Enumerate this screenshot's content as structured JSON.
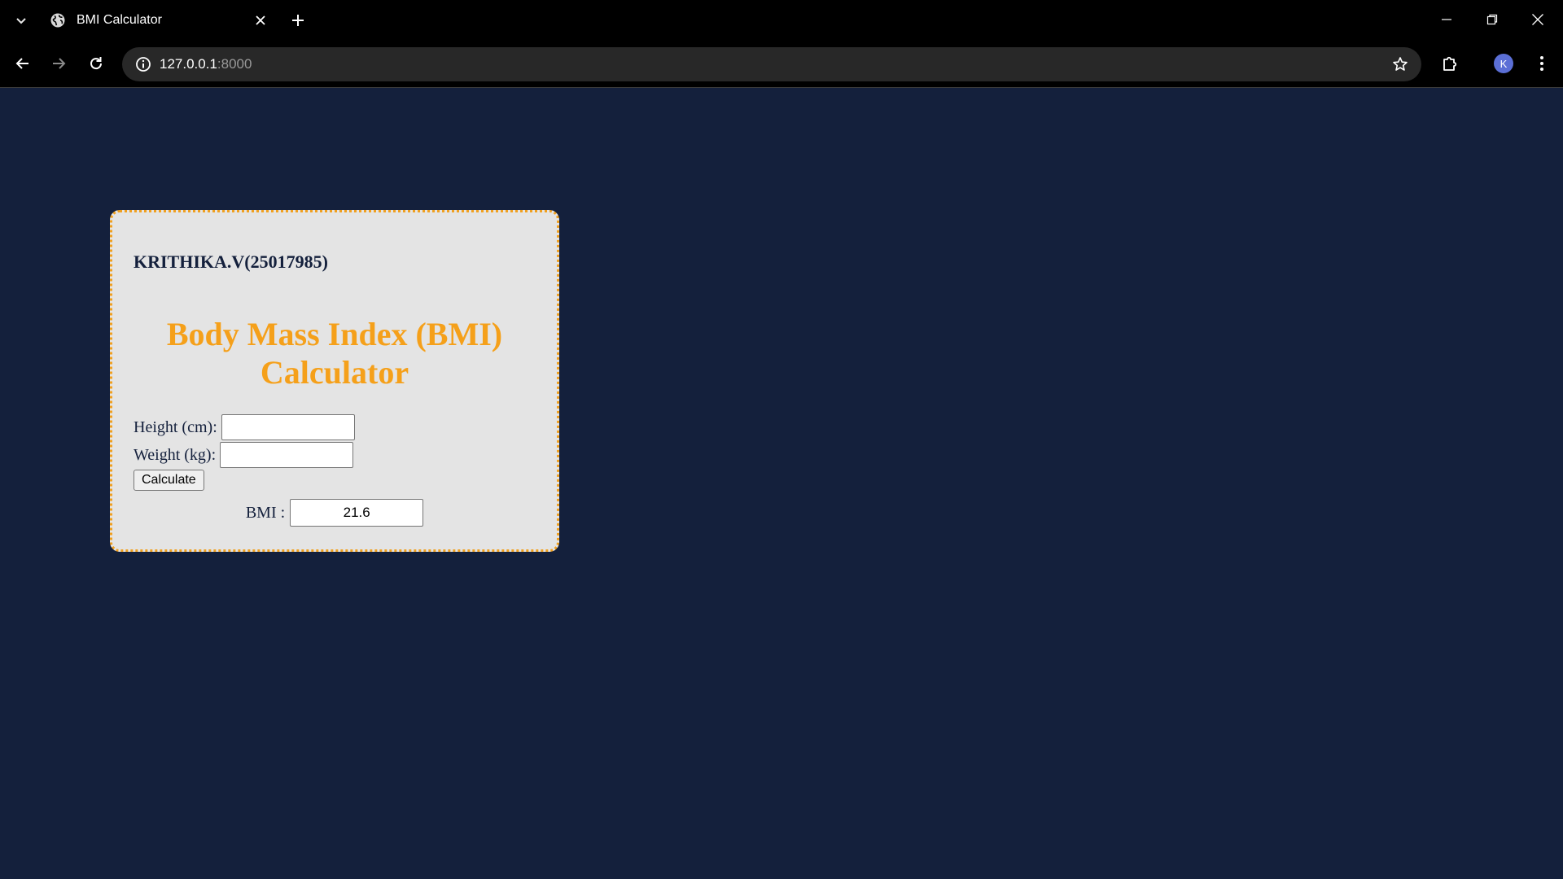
{
  "browser": {
    "tab": {
      "title": "BMI Calculator"
    },
    "address": {
      "host": "127.0.0.1",
      "port": ":8000"
    },
    "profile_initial": "K"
  },
  "page": {
    "student_label": "KRITHIKA.V(25017985)",
    "heading": "Body Mass Index (BMI) Calculator",
    "form": {
      "height_label": "Height (cm):",
      "height_value": "",
      "weight_label": "Weight (kg):",
      "weight_value": "",
      "calculate_label": "Calculate",
      "bmi_label": "BMI :",
      "bmi_value": "21.6"
    }
  },
  "colors": {
    "page_background": "#14203c",
    "card_background": "#e4e4e4",
    "card_border": "#f0a020",
    "heading": "#f5a01a",
    "avatar": "#5b6fd6"
  }
}
